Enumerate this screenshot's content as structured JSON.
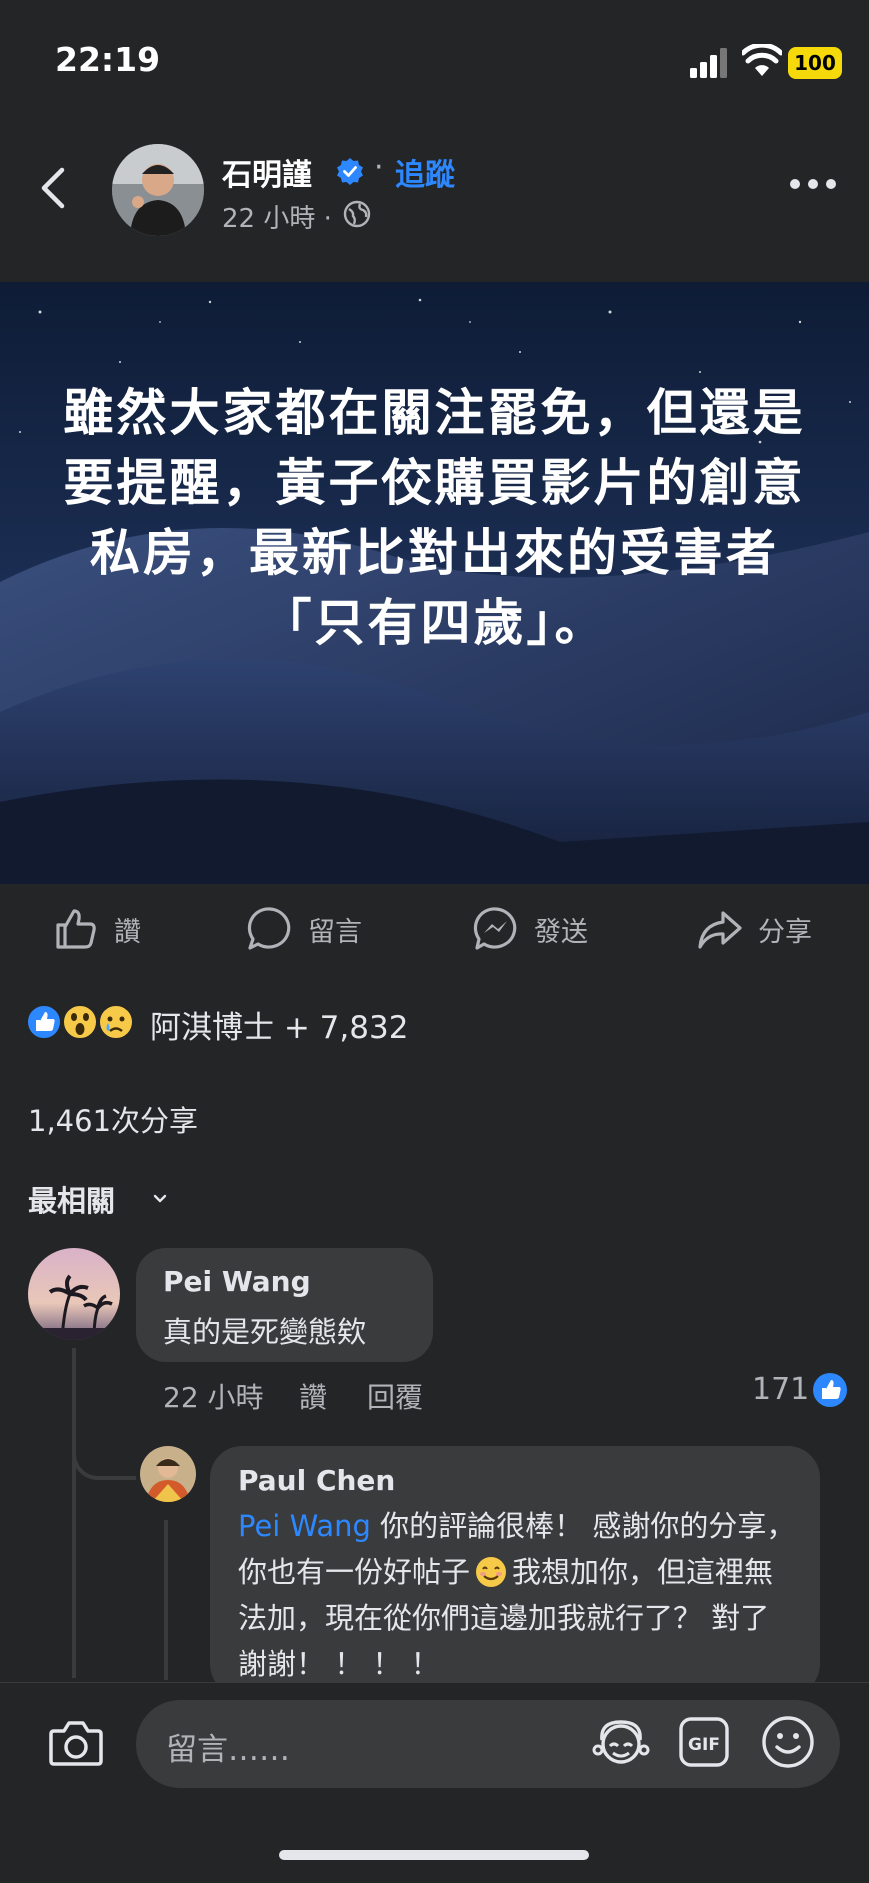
{
  "status_bar": {
    "time": "22:19",
    "battery": "100"
  },
  "post": {
    "author": "石明謹",
    "separator": "·",
    "follow_label": "追蹤",
    "time": "22 小時 ·",
    "image_text": "雖然大家都在關注罷免，但還是要提醒，黃子佼購買影片的創意私房，最新比對出來的受害者「只有四歲」。"
  },
  "actions": {
    "like": "讚",
    "comment": "留言",
    "send": "發送",
    "share": "分享"
  },
  "reactions": {
    "text": "阿淇博士 + 7,832"
  },
  "shares": "1,461次分享",
  "sort_label": "最相關",
  "comments": [
    {
      "name": "Pei Wang",
      "text": "真的是死變態欸",
      "time": "22 小時",
      "like_label": "讚",
      "reply_label": "回覆",
      "like_count": "171"
    },
    {
      "name": "Paul Chen",
      "mention": "Pei Wang",
      "text_part1": " 你的評論很棒！ 感謝你的分享，你也有一份好帖子",
      "text_part2": "我想加你，但這裡無法加，現在從你們這邊加我就行了？ 對了謝謝！ ！ ！ ！"
    }
  ],
  "composer": {
    "placeholder": "留言……"
  }
}
